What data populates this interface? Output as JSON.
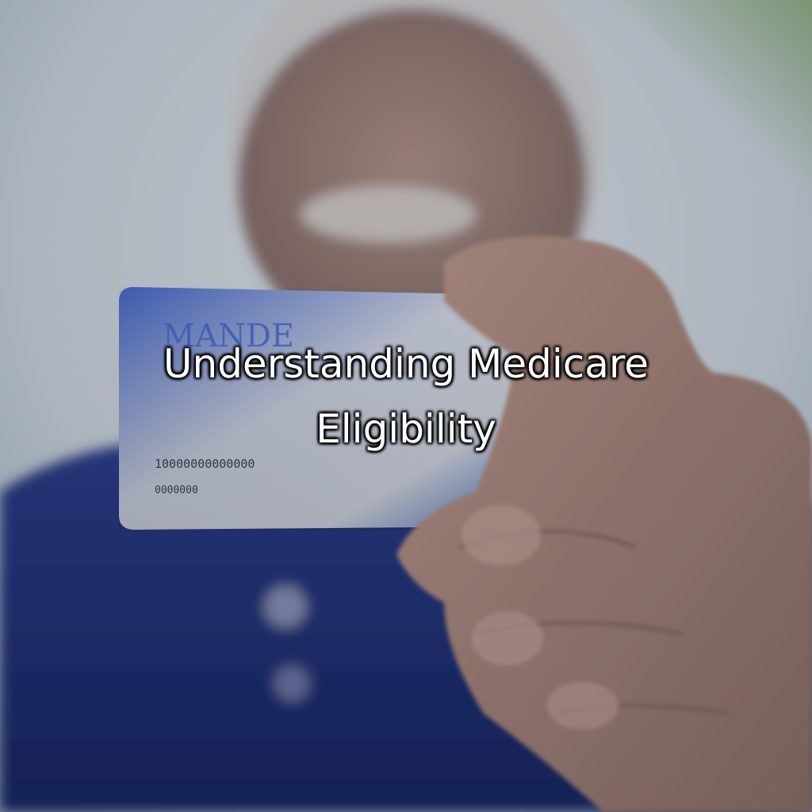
{
  "title": "Understanding Medicare Eligibility",
  "card": {
    "heading": "MANDE",
    "line_1": "10000000000000",
    "line_2": "0000000"
  },
  "colors": {
    "background_light": "#dde3e6",
    "shirt_blue": "#1f2f72",
    "card_blue": "#3f63c2",
    "card_white": "#e8ebf2",
    "skin": "#b28f80"
  }
}
